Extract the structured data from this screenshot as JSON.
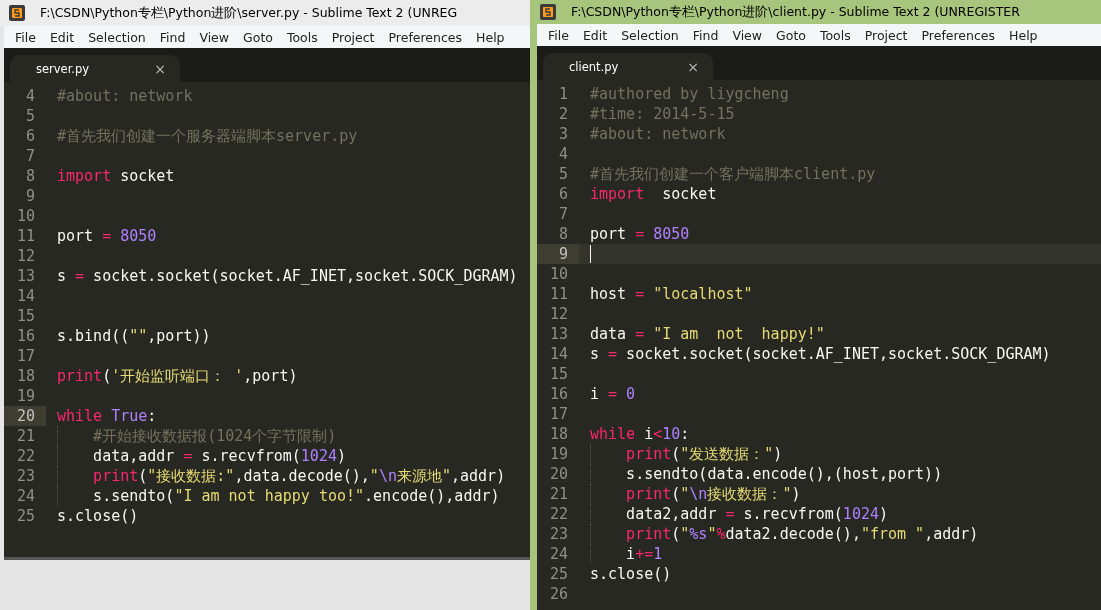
{
  "windows": [
    {
      "title": "F:\\CSDN\\Python专栏\\Python进阶\\server.py - Sublime Text 2 (UNREG",
      "active": false,
      "menu": [
        "File",
        "Edit",
        "Selection",
        "Find",
        "View",
        "Goto",
        "Tools",
        "Project",
        "Preferences",
        "Help"
      ],
      "tabs": [
        {
          "label": "server.py",
          "close": "×",
          "selected": true
        }
      ],
      "lines": [
        {
          "number": "4",
          "current": false,
          "tokens": [
            {
              "kind": "comment",
              "text": "#about: network"
            }
          ]
        },
        {
          "number": "5",
          "current": false
        },
        {
          "number": "6",
          "current": false,
          "tokens": [
            {
              "kind": "comment",
              "text": "#首先我们创建一个服务器端脚本server.py"
            }
          ]
        },
        {
          "number": "7",
          "current": false
        },
        {
          "number": "8",
          "current": false,
          "tokens": [
            {
              "kind": "keyword",
              "text": "import"
            },
            {
              "kind": "plain",
              "text": " socket"
            }
          ]
        },
        {
          "number": "9",
          "current": false
        },
        {
          "number": "10",
          "current": false
        },
        {
          "number": "11",
          "current": false,
          "tokens": [
            {
              "kind": "plain",
              "text": "port "
            },
            {
              "kind": "keyword",
              "text": "="
            },
            {
              "kind": "number",
              "text": " 8050"
            }
          ]
        },
        {
          "number": "12",
          "current": false
        },
        {
          "number": "13",
          "current": false,
          "tokens": [
            {
              "kind": "plain",
              "text": "s "
            },
            {
              "kind": "keyword",
              "text": "="
            },
            {
              "kind": "plain",
              "text": " socket.socket(socket.AF_INET,socket.SOCK_DGRAM)"
            }
          ]
        },
        {
          "number": "14",
          "current": false
        },
        {
          "number": "15",
          "current": false
        },
        {
          "number": "16",
          "current": false,
          "tokens": [
            {
              "kind": "plain",
              "text": "s.bind(("
            },
            {
              "kind": "string",
              "text": "\"\""
            },
            {
              "kind": "plain",
              "text": ",port))"
            }
          ]
        },
        {
          "number": "17",
          "current": false
        },
        {
          "number": "18",
          "current": false,
          "tokens": [
            {
              "kind": "keyword",
              "text": "print"
            },
            {
              "kind": "plain",
              "text": "("
            },
            {
              "kind": "string",
              "text": "'开始监听端口： '"
            },
            {
              "kind": "plain",
              "text": ",port)"
            }
          ]
        },
        {
          "number": "19",
          "current": false
        },
        {
          "number": "20",
          "current": true,
          "tokens": [
            {
              "kind": "keyword",
              "text": "while"
            },
            {
              "kind": "number",
              "text": " True"
            },
            {
              "kind": "plain",
              "text": ":"
            }
          ]
        },
        {
          "number": "21",
          "current": false,
          "indent": true,
          "tokens": [
            {
              "kind": "comment",
              "text": "#开始接收数据报(1024个字节限制)"
            }
          ]
        },
        {
          "number": "22",
          "current": false,
          "indent": true,
          "tokens": [
            {
              "kind": "plain",
              "text": "data,addr "
            },
            {
              "kind": "keyword",
              "text": "="
            },
            {
              "kind": "plain",
              "text": " s.recvfrom("
            },
            {
              "kind": "number",
              "text": "1024"
            },
            {
              "kind": "plain",
              "text": ")"
            }
          ]
        },
        {
          "number": "23",
          "current": false,
          "indent": true,
          "tokens": [
            {
              "kind": "keyword",
              "text": "print"
            },
            {
              "kind": "plain",
              "text": "("
            },
            {
              "kind": "string",
              "text": "\"接收数据:\""
            },
            {
              "kind": "plain",
              "text": ",data.decode(),"
            },
            {
              "kind": "string",
              "text": "\""
            },
            {
              "kind": "number",
              "text": "\\n"
            },
            {
              "kind": "string",
              "text": "来源地\""
            },
            {
              "kind": "plain",
              "text": ",addr)"
            }
          ]
        },
        {
          "number": "24",
          "current": false,
          "indent": true,
          "tokens": [
            {
              "kind": "plain",
              "text": "s.sendto("
            },
            {
              "kind": "string",
              "text": "\"I am not happy too!\""
            },
            {
              "kind": "plain",
              "text": ".encode(),addr)"
            }
          ]
        },
        {
          "number": "25",
          "current": false,
          "tokens": [
            {
              "kind": "plain",
              "text": "s.close()"
            }
          ]
        }
      ]
    },
    {
      "title": "F:\\CSDN\\Python专栏\\Python进阶\\client.py - Sublime Text 2 (UNREGISTER",
      "active": true,
      "menu": [
        "File",
        "Edit",
        "Selection",
        "Find",
        "View",
        "Goto",
        "Tools",
        "Project",
        "Preferences",
        "Help"
      ],
      "tabs": [
        {
          "label": "client.py",
          "close": "×",
          "selected": true
        }
      ],
      "lines": [
        {
          "number": "1",
          "current": false,
          "tokens": [
            {
              "kind": "comment",
              "text": "#authored by liygcheng"
            }
          ]
        },
        {
          "number": "2",
          "current": false,
          "tokens": [
            {
              "kind": "comment",
              "text": "#time: 2014-5-15"
            }
          ]
        },
        {
          "number": "3",
          "current": false,
          "tokens": [
            {
              "kind": "comment",
              "text": "#about: network"
            }
          ]
        },
        {
          "number": "4",
          "current": false
        },
        {
          "number": "5",
          "current": false,
          "tokens": [
            {
              "kind": "comment",
              "text": "#首先我们创建一个客户端脚本client.py"
            }
          ]
        },
        {
          "number": "6",
          "current": false,
          "tokens": [
            {
              "kind": "keyword",
              "text": "import"
            },
            {
              "kind": "plain",
              "text": "  socket"
            }
          ]
        },
        {
          "number": "7",
          "current": false
        },
        {
          "number": "8",
          "current": false,
          "tokens": [
            {
              "kind": "plain",
              "text": "port "
            },
            {
              "kind": "keyword",
              "text": "="
            },
            {
              "kind": "number",
              "text": " 8050"
            }
          ]
        },
        {
          "number": "9",
          "current": true
        },
        {
          "number": "10",
          "current": false
        },
        {
          "number": "11",
          "current": false,
          "tokens": [
            {
              "kind": "plain",
              "text": "host "
            },
            {
              "kind": "keyword",
              "text": "="
            },
            {
              "kind": "string",
              "text": " \"localhost\""
            }
          ]
        },
        {
          "number": "12",
          "current": false
        },
        {
          "number": "13",
          "current": false,
          "tokens": [
            {
              "kind": "plain",
              "text": "data "
            },
            {
              "kind": "keyword",
              "text": "="
            },
            {
              "kind": "string",
              "text": " \"I am  not  happy!\""
            }
          ]
        },
        {
          "number": "14",
          "current": false,
          "tokens": [
            {
              "kind": "plain",
              "text": "s "
            },
            {
              "kind": "keyword",
              "text": "="
            },
            {
              "kind": "plain",
              "text": " socket.socket(socket.AF_INET,socket.SOCK_DGRAM)"
            }
          ]
        },
        {
          "number": "15",
          "current": false
        },
        {
          "number": "16",
          "current": false,
          "tokens": [
            {
              "kind": "plain",
              "text": "i "
            },
            {
              "kind": "keyword",
              "text": "="
            },
            {
              "kind": "number",
              "text": " 0"
            }
          ]
        },
        {
          "number": "17",
          "current": false
        },
        {
          "number": "18",
          "current": false,
          "tokens": [
            {
              "kind": "keyword",
              "text": "while"
            },
            {
              "kind": "plain",
              "text": " i"
            },
            {
              "kind": "keyword",
              "text": "<"
            },
            {
              "kind": "number",
              "text": "10"
            },
            {
              "kind": "plain",
              "text": ":"
            }
          ]
        },
        {
          "number": "19",
          "current": false,
          "indent": true,
          "tokens": [
            {
              "kind": "keyword",
              "text": "print"
            },
            {
              "kind": "plain",
              "text": "("
            },
            {
              "kind": "string",
              "text": "\"发送数据：\""
            },
            {
              "kind": "plain",
              "text": ")"
            }
          ]
        },
        {
          "number": "20",
          "current": false,
          "indent": true,
          "tokens": [
            {
              "kind": "plain",
              "text": "s.sendto(data.encode(),(host,port))"
            }
          ]
        },
        {
          "number": "21",
          "current": false,
          "indent": true,
          "tokens": [
            {
              "kind": "keyword",
              "text": "print"
            },
            {
              "kind": "plain",
              "text": "("
            },
            {
              "kind": "string",
              "text": "\""
            },
            {
              "kind": "number",
              "text": "\\n"
            },
            {
              "kind": "string",
              "text": "接收数据：\""
            },
            {
              "kind": "plain",
              "text": ")"
            }
          ]
        },
        {
          "number": "22",
          "current": false,
          "indent": true,
          "tokens": [
            {
              "kind": "plain",
              "text": "data2,addr "
            },
            {
              "kind": "keyword",
              "text": "="
            },
            {
              "kind": "plain",
              "text": " s.recvfrom("
            },
            {
              "kind": "number",
              "text": "1024"
            },
            {
              "kind": "plain",
              "text": ")"
            }
          ]
        },
        {
          "number": "23",
          "current": false,
          "indent": true,
          "tokens": [
            {
              "kind": "keyword",
              "text": "print"
            },
            {
              "kind": "plain",
              "text": "("
            },
            {
              "kind": "string",
              "text": "\""
            },
            {
              "kind": "number",
              "text": "%s"
            },
            {
              "kind": "string",
              "text": "\""
            },
            {
              "kind": "keyword",
              "text": "%"
            },
            {
              "kind": "plain",
              "text": "data2.decode(),"
            },
            {
              "kind": "string",
              "text": "\"from \""
            },
            {
              "kind": "plain",
              "text": ",addr)"
            }
          ]
        },
        {
          "number": "24",
          "current": false,
          "indent": true,
          "tokens": [
            {
              "kind": "plain",
              "text": "i"
            },
            {
              "kind": "keyword",
              "text": "+="
            },
            {
              "kind": "number",
              "text": "1"
            }
          ]
        },
        {
          "number": "25",
          "current": false,
          "tokens": [
            {
              "kind": "plain",
              "text": "s.close()"
            }
          ]
        },
        {
          "number": "26",
          "current": false
        }
      ]
    }
  ]
}
